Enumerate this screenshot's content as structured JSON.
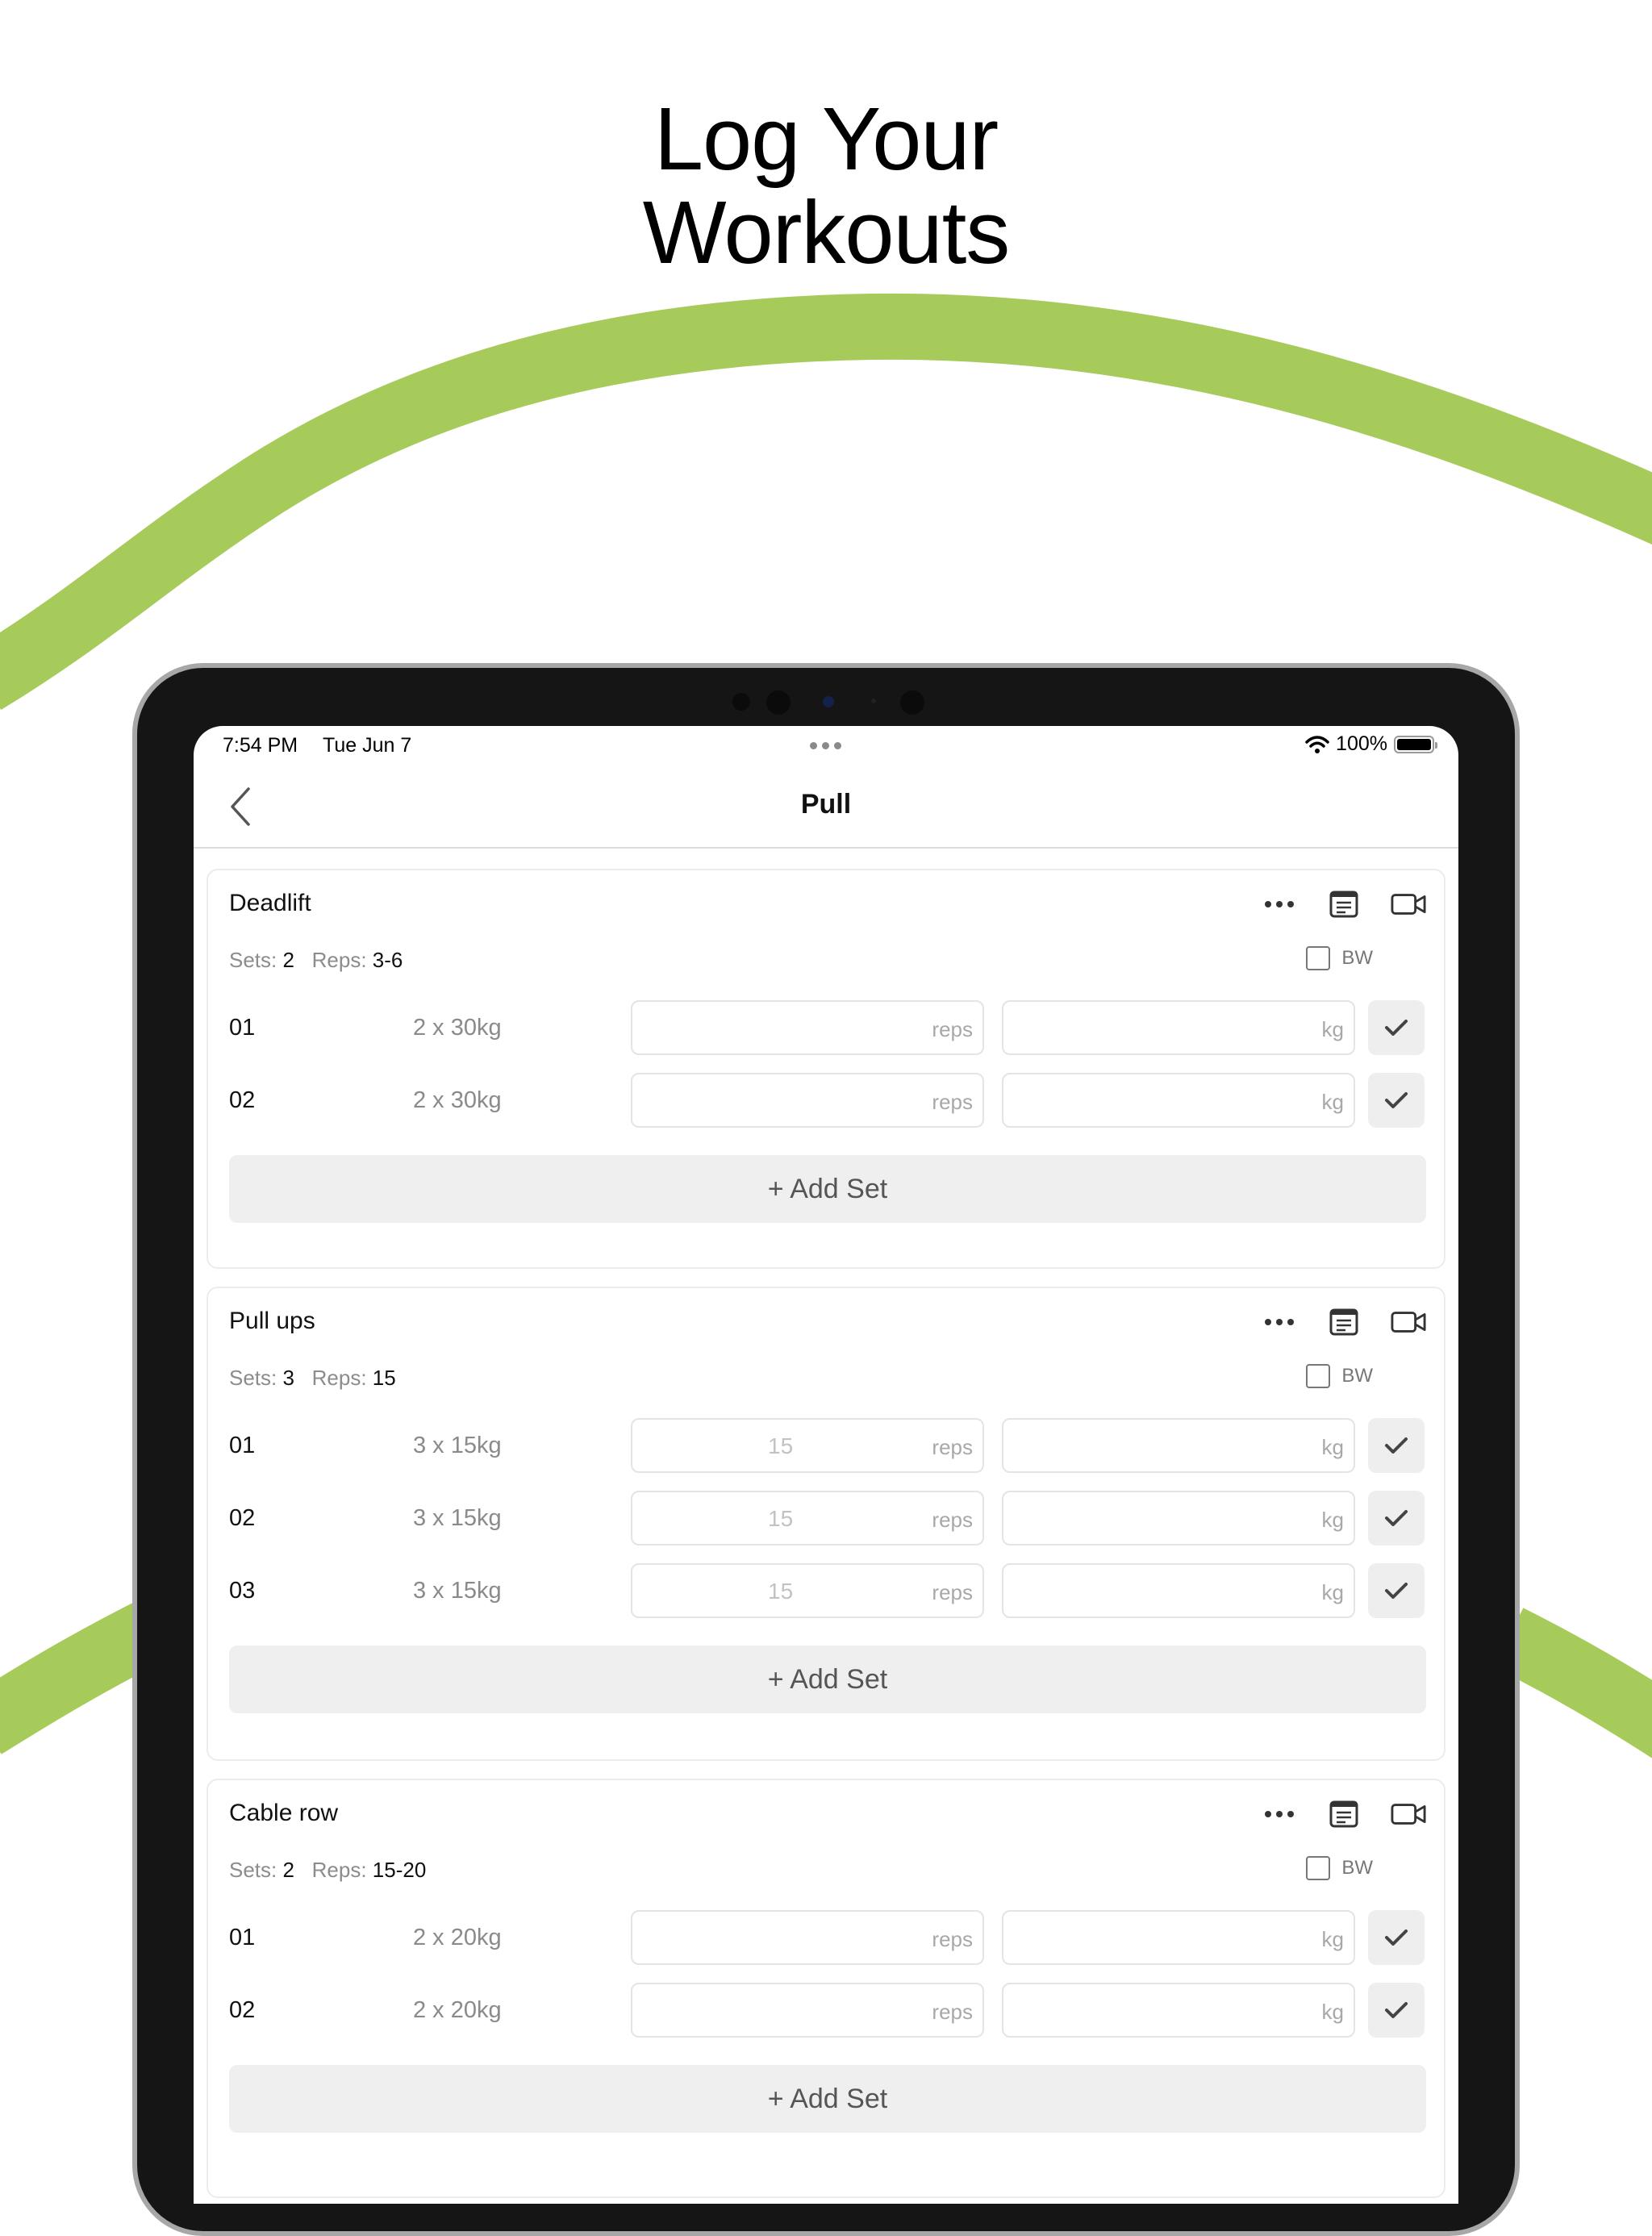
{
  "headline": {
    "line1": "Log Your",
    "line2": "Workouts"
  },
  "colors": {
    "accent_wave": "#a6cb5a",
    "device_frame": "#151515"
  },
  "status_bar": {
    "time": "7:54 PM",
    "date": "Tue Jun 7",
    "battery": "100%"
  },
  "nav": {
    "title": "Pull",
    "back_icon": "chevron-left-icon"
  },
  "exercises": [
    {
      "name": "Deadlift",
      "sets_label": "Sets:",
      "sets_value": "2",
      "reps_label": "Reps:",
      "reps_value": "3-6",
      "bw_label": "BW",
      "rows": [
        {
          "num": "01",
          "target": "2 x 30kg",
          "reps_value": "",
          "reps_unit": "reps",
          "kg_unit": "kg"
        },
        {
          "num": "02",
          "target": "2 x 30kg",
          "reps_value": "",
          "reps_unit": "reps",
          "kg_unit": "kg"
        }
      ],
      "add_set": "+ Add Set"
    },
    {
      "name": "Pull ups",
      "sets_label": "Sets:",
      "sets_value": "3",
      "reps_label": "Reps:",
      "reps_value": "15",
      "bw_label": "BW",
      "rows": [
        {
          "num": "01",
          "target": "3 x 15kg",
          "reps_value": "15",
          "reps_unit": "reps",
          "kg_unit": "kg"
        },
        {
          "num": "02",
          "target": "3 x 15kg",
          "reps_value": "15",
          "reps_unit": "reps",
          "kg_unit": "kg"
        },
        {
          "num": "03",
          "target": "3 x 15kg",
          "reps_value": "15",
          "reps_unit": "reps",
          "kg_unit": "kg"
        }
      ],
      "add_set": "+ Add Set"
    },
    {
      "name": "Cable row",
      "sets_label": "Sets:",
      "sets_value": "2",
      "reps_label": "Reps:",
      "reps_value": "15-20",
      "bw_label": "BW",
      "rows": [
        {
          "num": "01",
          "target": "2 x 20kg",
          "reps_value": "",
          "reps_unit": "reps",
          "kg_unit": "kg"
        },
        {
          "num": "02",
          "target": "2 x 20kg",
          "reps_value": "",
          "reps_unit": "reps",
          "kg_unit": "kg"
        }
      ],
      "add_set": "+ Add Set"
    }
  ]
}
